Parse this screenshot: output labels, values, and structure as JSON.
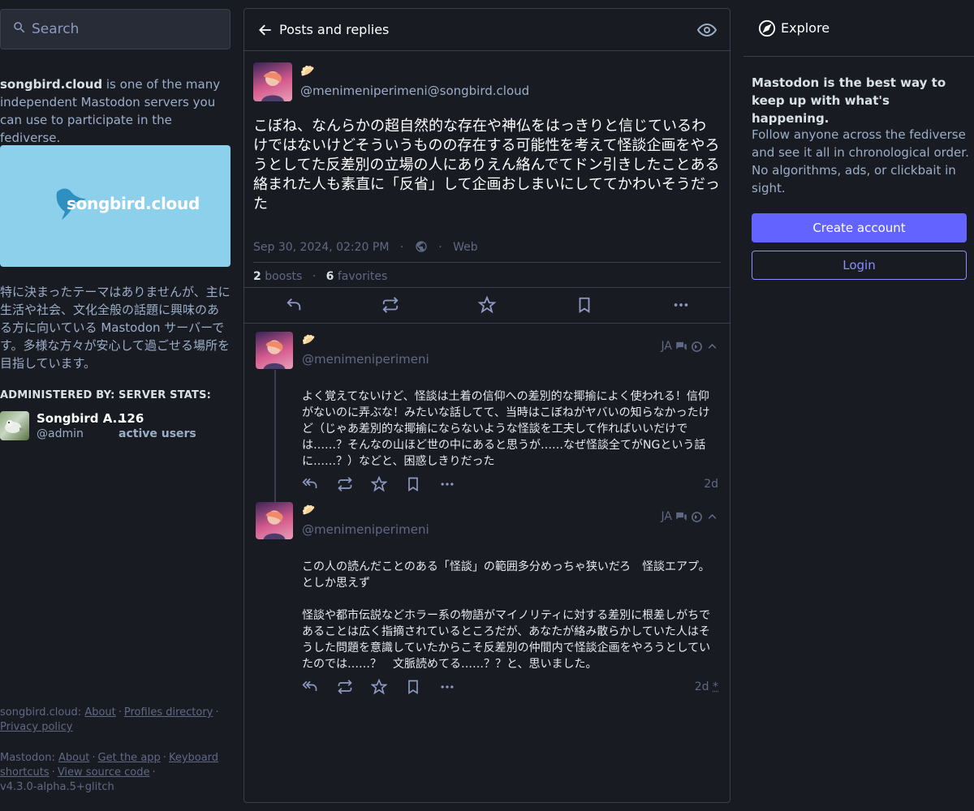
{
  "search": {
    "placeholder": "Search"
  },
  "server": {
    "name": "songbird.cloud",
    "intro_rest": " is one of the many independent Mastodon servers you can use to participate in the fediverse.",
    "hero_brand": "songbird.cloud",
    "description": "特に決まったテーマはありませんが、主に生活や社会、文化全般の話題に興味のある方に向いている Mastodon サーバーです。多様な方々が安心して過ごせる場所を目指しています。",
    "administered_by_label": "ADMINISTERED BY:",
    "server_stats_label": "SERVER STATS:",
    "admin_name": "Songbird A...",
    "admin_handle": "@admin",
    "active_users_count": "126",
    "active_users_label": "active users"
  },
  "footer": {
    "server_prefix": "songbird.cloud",
    "about": "About",
    "profiles_directory": "Profiles directory",
    "privacy_policy": "Privacy policy",
    "mastodon_prefix": "Mastodon",
    "about2": "About",
    "get_the_app": "Get the app",
    "keyboard_shortcuts": "Keyboard shortcuts",
    "view_source_code": "View source code",
    "version": "v4.3.0-alpha.5+glitch"
  },
  "column": {
    "title": "Posts and replies"
  },
  "main_post": {
    "emoji": "🥟",
    "handle": "@menimeniperimeni@songbird.cloud",
    "text": "こぼね、なんらかの超自然的な存在や神仏をはっきりと信じているわけではないけどそういうものの存在する可能性を考えて怪談企画をやろうとしてた反差別の立場の人にありえん絡んでてドン引きしたことある　絡まれた人も素直に「反省」して企画おしまいにしててかわいそうだった",
    "timestamp": "Sep 30, 2024, 02:20 PM",
    "app": "Web",
    "boosts_count": "2",
    "boosts_label": "boosts",
    "favorites_count": "6",
    "favorites_label": "favorites"
  },
  "replies": [
    {
      "emoji": "🥟",
      "handle": "@menimeniperimeni",
      "lang": "JA",
      "text": "よく覚えてないけど、怪談は土着の信仰への差別的な揶揄によく使われる！信仰がないのに弄ぶな！みたいな話してて、当時はこぼねがヤバいの知らなかったけど（じゃあ差別的な揶揄にならないような怪談を工夫して作ればいいだけでは……？そんなの山ほど世の中にあると思うが……なぜ怪談全てがNGという話に……？）などと、困惑しきりだった",
      "time": "2d"
    },
    {
      "emoji": "🥟",
      "handle": "@menimeniperimeni",
      "lang": "JA",
      "text_p1": "この人の読んだことのある「怪談」の範囲多分めっちゃ狭いだろ　怪談エアプ。としか思えず",
      "text_p2": "怪談や都市伝説などホラー系の物語がマイノリティに対する差別に根差しがちであることは広く指摘されているところだが、あなたが絡み散らかしていた人はそうした問題を意識していたからこそ反差別の仲間内で怪談企画をやろうとしていたのでは……？　文脈読めてる……？？と、思いました。",
      "time": "2d",
      "edited_mark": "*"
    }
  ],
  "explore": {
    "label": "Explore",
    "title": "Mastodon is the best way to keep up with what's happening.",
    "body": "Follow anyone across the fediverse and see it all in chronological order. No algorithms, ads, or clickbait in sight.",
    "create_account": "Create account",
    "login": "Login"
  },
  "colors": {
    "background": "#191b22",
    "border": "#393f4f",
    "accent": "#6364ff",
    "accent_light": "#8c8dff",
    "muted": "#606984",
    "secondary_text": "#9baec8"
  }
}
